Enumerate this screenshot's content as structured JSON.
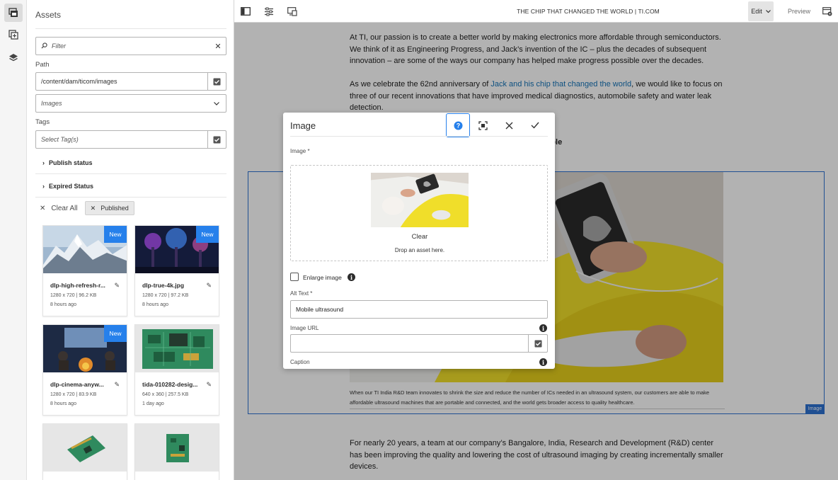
{
  "rail": {
    "items": [
      {
        "icon": "assets-icon"
      },
      {
        "icon": "components-icon"
      },
      {
        "icon": "layers-icon"
      }
    ]
  },
  "assets_panel": {
    "title": "Assets",
    "filter_placeholder": "Filter",
    "path_label": "Path",
    "path_value": "/content/dam/ticom/images",
    "type_value": "Images",
    "tags_label": "Tags",
    "tags_placeholder": "Select Tag(s)",
    "sections": [
      "Publish status",
      "Expired Status"
    ],
    "clear_all": "Clear All",
    "active_filter": "Published",
    "cards": [
      {
        "name": "dlp-high-refresh-r...",
        "meta": "1280 x 720 | 96.2 KB",
        "time": "8 hours ago",
        "badge": "New"
      },
      {
        "name": "dlp-true-4k.jpg",
        "meta": "1280 x 720 | 97.2 KB",
        "time": "8 hours ago",
        "badge": "New"
      },
      {
        "name": "dlp-cinema-anyw...",
        "meta": "1280 x 720 | 83.9 KB",
        "time": "8 hours ago",
        "badge": "New"
      },
      {
        "name": "tida-010282-desig...",
        "meta": "640 x 360 | 257.5 KB",
        "time": "1 day ago",
        "badge": ""
      }
    ]
  },
  "toolbar": {
    "page_title": "THE CHIP THAT CHANGED THE WORLD | TI.COM",
    "edit_label": "Edit",
    "preview_label": "Preview"
  },
  "content": {
    "para1": "At TI, our passion is to create a better world by making electronics more affordable through semiconductors. We think of it as Engineering Progress, and Jack’s invention of the IC – plus the decades of subsequent innovation – are some of the ways our company has helped make progress possible over the decades.",
    "para2_before": "As we celebrate the 62nd anniversary of ",
    "para2_link": "Jack and his chip that changed the world",
    "para2_after": ", we would like to focus on three of our recent innovations that have improved medical diagnostics, automobile safety and water leak detection.",
    "heading_partial": "ssible",
    "caption": "When our TI India R&D team innovates to shrink the size and reduce the number of ICs needed in an ultrasound system, our customers are able to make affordable ultrasound machines that are portable and connected, and the world gets broader access to quality healthcare.",
    "image_tag": "Image",
    "para3": "For nearly 20 years, a team at our company’s Bangalore, India, Research and Development (R&D) center has been improving the quality and lowering the cost of ultrasound imaging by creating incrementally smaller devices."
  },
  "dialog": {
    "title": "Image",
    "image_label": "Image *",
    "clear_label": "Clear",
    "drop_hint": "Drop an asset here.",
    "enlarge_label": "Enlarge image",
    "alt_label": "Alt Text *",
    "alt_value": "Mobile ultrasound",
    "url_label": "Image URL",
    "url_value": "",
    "caption_label": "Caption"
  },
  "colors": {
    "accent": "#2680eb",
    "selection": "#2d72d2",
    "link": "#1473b8",
    "photo_yellow": "#f0de2a"
  }
}
